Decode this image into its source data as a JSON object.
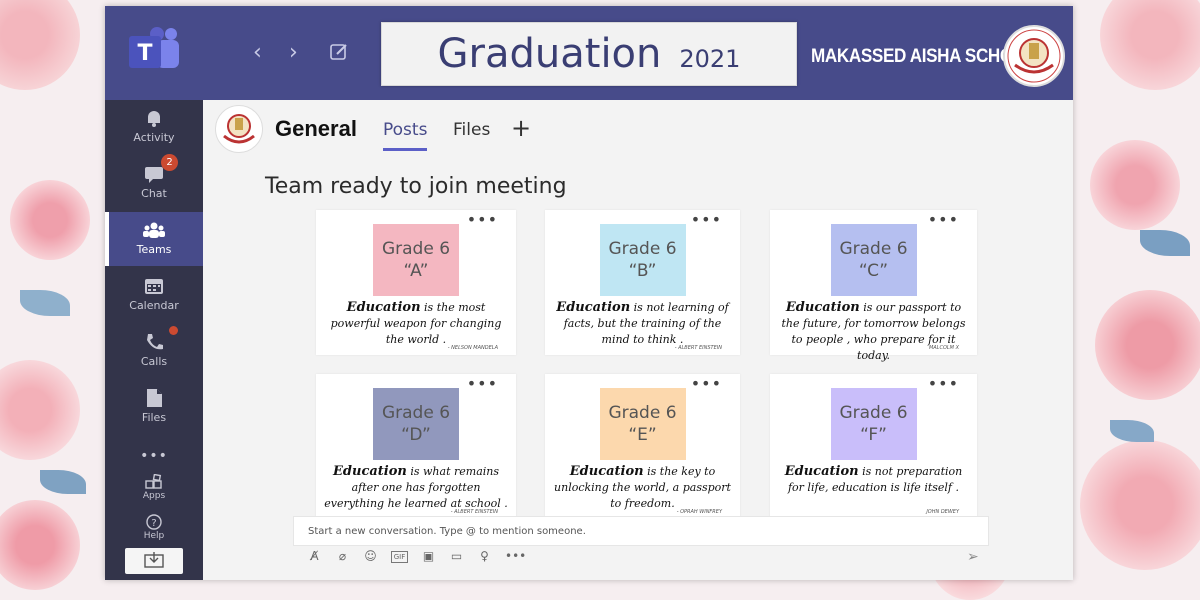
{
  "app": {
    "title_main": "Graduation",
    "title_year": "2021",
    "school_name": "MAKASSED AISHA SCHOOL"
  },
  "sidebar": {
    "items": [
      {
        "label": "Activity",
        "icon": "bell-icon"
      },
      {
        "label": "Chat",
        "icon": "chat-icon",
        "badge": "2"
      },
      {
        "label": "Teams",
        "icon": "teams-icon"
      },
      {
        "label": "Calendar",
        "icon": "calendar-icon"
      },
      {
        "label": "Calls",
        "icon": "phone-icon"
      },
      {
        "label": "Files",
        "icon": "file-icon"
      },
      {
        "label": "Apps",
        "icon": "apps-icon"
      },
      {
        "label": "Help",
        "icon": "help-icon"
      }
    ],
    "more": "•••"
  },
  "channel": {
    "name": "General",
    "tabs": [
      "Posts",
      "Files"
    ],
    "add_tab": "+"
  },
  "main": {
    "meeting_title": "Team ready to join meeting"
  },
  "cards": [
    {
      "grade": "Grade 6",
      "section": "“A”",
      "color": "#f4b7c1",
      "quote_lead": "Education",
      "quote_rest": " is the most  powerful weapon for changing the world .",
      "author": "- NELSON MANDELA"
    },
    {
      "grade": "Grade 6",
      "section": "“B”",
      "color": "#bfe6f3",
      "quote_lead": "Education",
      "quote_rest": " is not learning of facts, but the training of the mind to think .",
      "author": "- ALBERT EINSTEIN"
    },
    {
      "grade": "Grade 6",
      "section": "“C”",
      "color": "#b5bff0",
      "quote_lead": "Education",
      "quote_rest": " is our passport to the future, for tomorrow belongs to people , who prepare for it today.",
      "author": "MALCOLM X"
    },
    {
      "grade": "Grade 6",
      "section": "“D”",
      "color": "#9198bd",
      "quote_lead": "Education",
      "quote_rest": " is what remains after one has forgotten everything he learned at school .",
      "author": "- ALBERT EINSTEIN"
    },
    {
      "grade": "Grade 6",
      "section": "“E”",
      "color": "#fcd8ad",
      "quote_lead": "Education",
      "quote_rest": " is the key to unlocking the world, a passport to freedom.",
      "author": "- OPRAH WINFREY"
    },
    {
      "grade": "Grade 6",
      "section": "“F”",
      "color": "#c9befa",
      "quote_lead": "Education",
      "quote_rest": " is not preparation for life, education is life itself .",
      "author": "JOHN DEWEY"
    }
  ],
  "compose": {
    "placeholder": "Start a new conversation. Type @ to mention someone."
  },
  "colors": {
    "brand": "#474b8a",
    "rail": "#33344a",
    "badge": "#cc4a31"
  }
}
